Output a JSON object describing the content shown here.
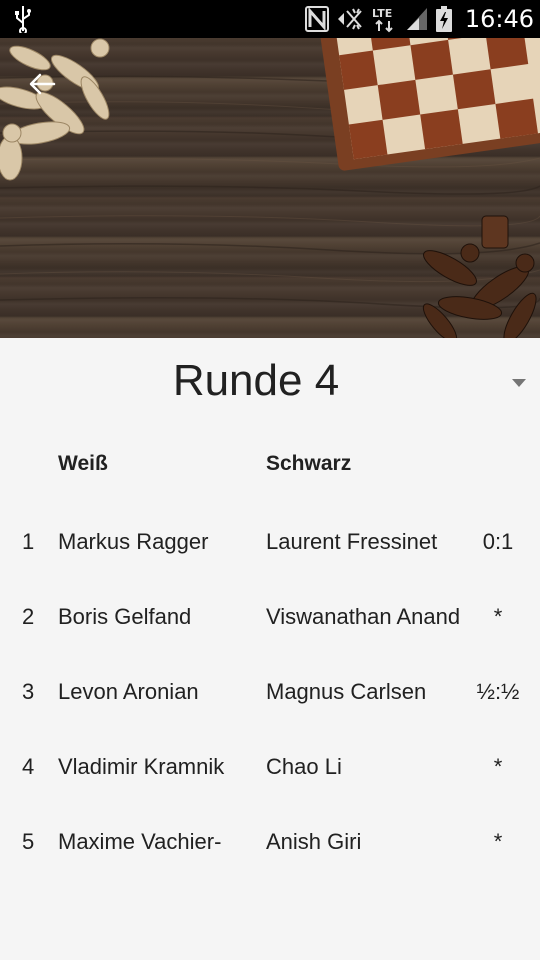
{
  "status_bar": {
    "time": "16:46",
    "icons": [
      "usb-icon",
      "nfc-icon",
      "mute-icon",
      "lte-icon",
      "signal-icon",
      "battery-charging-icon"
    ],
    "lte_label": "LTE"
  },
  "header": {
    "back_icon": "arrow-back-icon"
  },
  "round": {
    "title": "Runde 4"
  },
  "table": {
    "headers": {
      "white": "Weiß",
      "black": "Schwarz"
    },
    "rows": [
      {
        "num": "1",
        "white": "Markus Ragger",
        "black": "Laurent Fressinet",
        "result": "0:1"
      },
      {
        "num": "2",
        "white": "Boris Gelfand",
        "black": "Viswanathan Anand",
        "result": "*"
      },
      {
        "num": "3",
        "white": "Levon Aronian",
        "black": "Magnus Carlsen",
        "result": "½:½"
      },
      {
        "num": "4",
        "white": "Vladimir Kramnik",
        "black": "Chao Li",
        "result": "*"
      },
      {
        "num": "5",
        "white": "Maxime Vachier-",
        "black": "Anish Giri",
        "result": "*"
      }
    ]
  },
  "colors": {
    "status_bar": "#000000",
    "background": "#f5f5f5",
    "text": "#212121",
    "wood": "#43352b"
  }
}
